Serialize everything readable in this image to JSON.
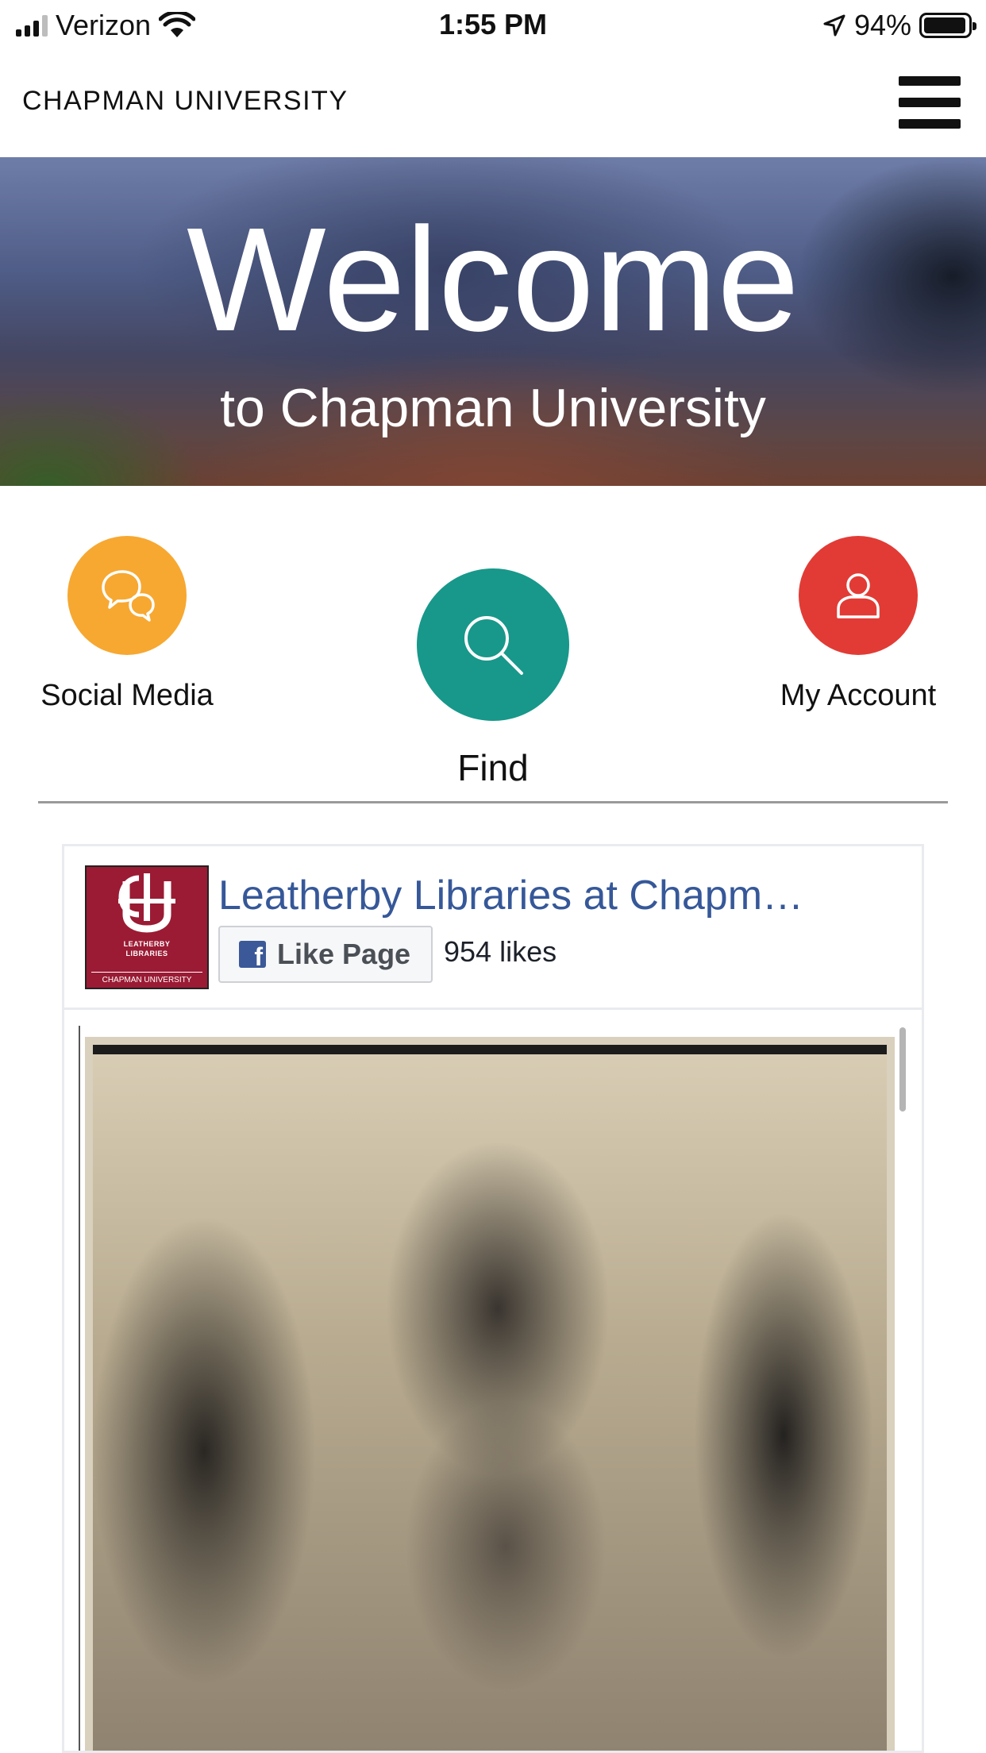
{
  "status_bar": {
    "carrier": "Verizon",
    "time": "1:55 PM",
    "battery_percent": "94%"
  },
  "header": {
    "brand": "CHAPMAN UNIVERSITY"
  },
  "hero": {
    "title": "Welcome",
    "subtitle": "to Chapman University"
  },
  "quick_actions": [
    {
      "label": "Social Media",
      "icon": "chat-bubbles-icon",
      "color": "#f7a831"
    },
    {
      "label": "Find",
      "icon": "search-icon",
      "color": "#17988a"
    },
    {
      "label": "My Account",
      "icon": "user-icon",
      "color": "#e23b35"
    }
  ],
  "facebook": {
    "page_name": "Leatherby Libraries at Chapm…",
    "like_button_label": "Like Page",
    "likes": "954 likes",
    "logo_lines": [
      "LEATHERBY",
      "LIBRARIES",
      "CHAPMAN UNIVERSITY"
    ],
    "brand_color": "#3b5998"
  },
  "colors": {
    "link": "#365899",
    "logo_bg": "#9b1b34"
  }
}
